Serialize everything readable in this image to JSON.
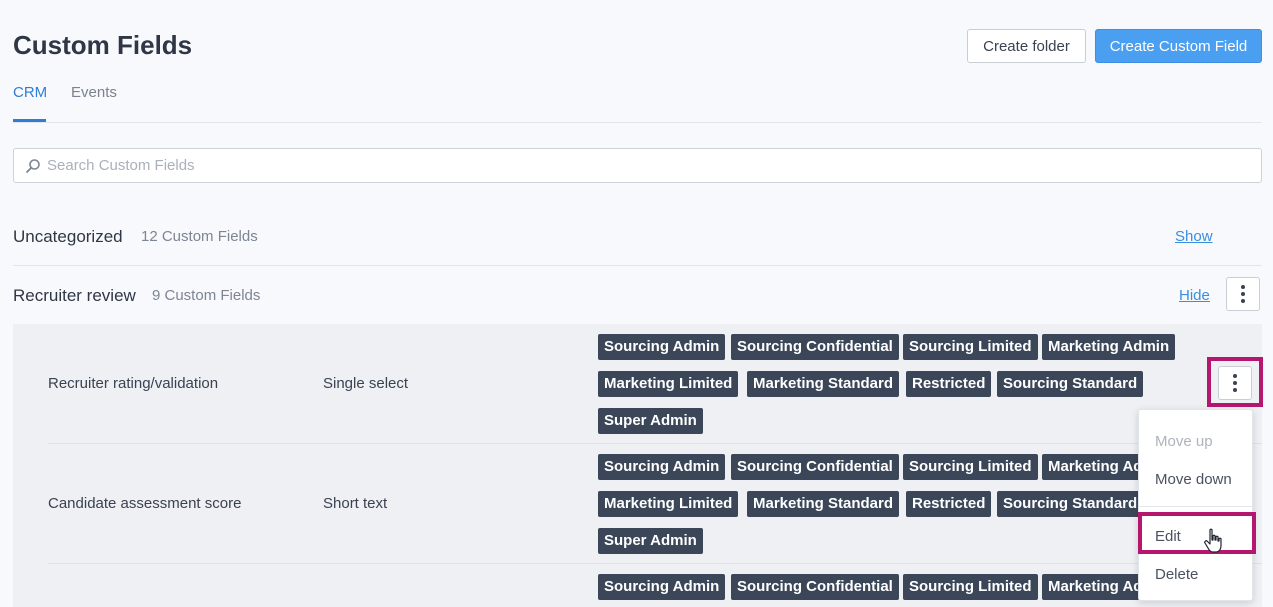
{
  "page": {
    "title": "Custom Fields",
    "buttons": {
      "create_folder": "Create folder",
      "create_custom_field": "Create Custom Field"
    },
    "tabs": [
      {
        "label": "CRM",
        "active": true
      },
      {
        "label": "Events",
        "active": false
      }
    ],
    "search": {
      "placeholder": "Search Custom Fields"
    }
  },
  "categories": [
    {
      "name": "Uncategorized",
      "count_label": "12 Custom Fields",
      "toggle_label": "Show"
    },
    {
      "name": "Recruiter review",
      "count_label": "9 Custom Fields",
      "toggle_label": "Hide"
    }
  ],
  "fields": [
    {
      "name": "Recruiter rating/validation",
      "type": "Single select",
      "tags": [
        "Sourcing Admin",
        "Sourcing Confidential",
        "Sourcing Limited",
        "Marketing Admin",
        "Marketing Limited",
        "Marketing Standard",
        "Restricted",
        "Sourcing Standard",
        "Super Admin"
      ]
    },
    {
      "name": "Candidate assessment score",
      "type": "Short text",
      "tags": [
        "Sourcing Admin",
        "Sourcing Confidential",
        "Sourcing Limited",
        "Marketing Ad",
        "Marketing Limited",
        "Marketing Standard",
        "Restricted",
        "Sourcing Standard",
        "Super Admin"
      ]
    },
    {
      "name": "",
      "type": "",
      "tags": [
        "Sourcing Admin",
        "Sourcing Confidential",
        "Sourcing Limited",
        "Marketing Ad"
      ]
    }
  ],
  "row_menu": {
    "items": [
      {
        "label": "Move up",
        "enabled": false
      },
      {
        "label": "Move down",
        "enabled": true
      },
      {
        "label": "Edit",
        "enabled": true
      },
      {
        "label": "Delete",
        "enabled": true
      }
    ]
  },
  "colors": {
    "accent": "#2d7fd3",
    "primary_button": "#4a9ff0",
    "tag_background": "#3b4659",
    "highlight": "#b5166e"
  }
}
